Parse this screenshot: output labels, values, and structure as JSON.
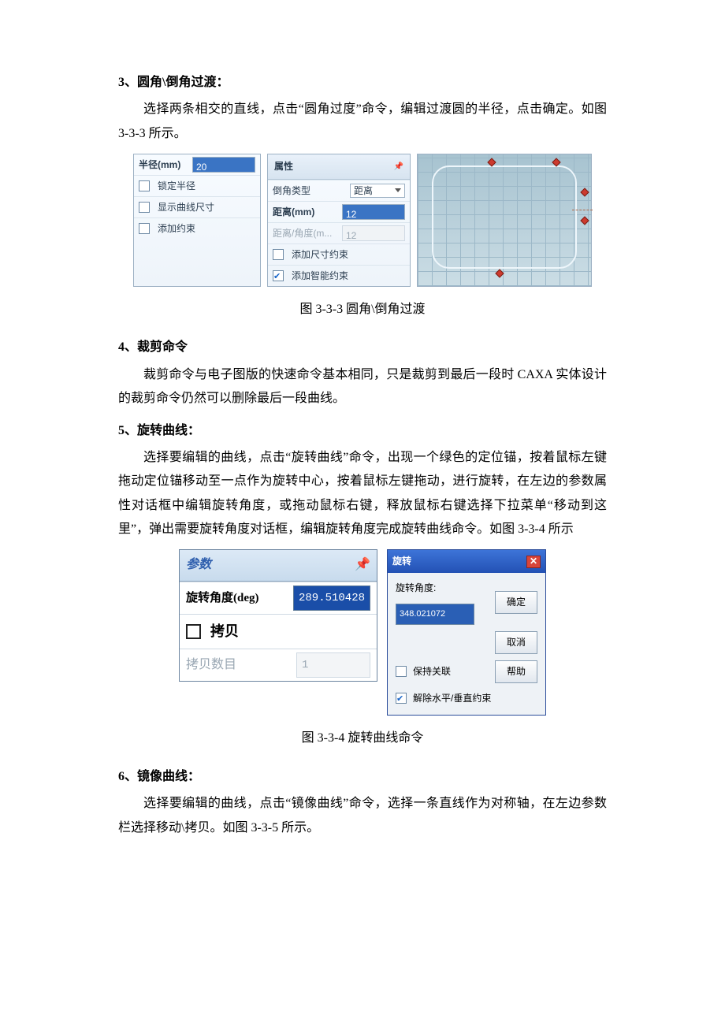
{
  "sec3": {
    "heading": "3、圆角\\倒角过渡：",
    "para": "选择两条相交的直线，点击“圆角过度”命令，编辑过渡圆的半径，点击确定。如图 3-3-3 所示。",
    "caption": "图 3-3-3 圆角\\倒角过渡",
    "panel_left": {
      "radius_label": "半径(mm)",
      "radius_value": "20",
      "lock_radius": "锁定半径",
      "show_dim": "显示曲线尺寸",
      "add_constraint": "添加约束"
    },
    "panel_mid": {
      "title": "属性",
      "chamfer_type_label": "倒角类型",
      "chamfer_type_value": "距离",
      "distance_label": "距离(mm)",
      "distance_value": "12",
      "dist_angle_label": "距离/角度(m...",
      "dist_angle_value": "12",
      "add_dim_constraint": "添加尺寸约束",
      "add_smart_constraint": "添加智能约束"
    }
  },
  "sec4": {
    "heading": "4、裁剪命令",
    "para": "裁剪命令与电子图版的快速命令基本相同，只是裁剪到最后一段时 CAXA 实体设计的裁剪命令仍然可以删除最后一段曲线。"
  },
  "sec5": {
    "heading": "5、旋转曲线：",
    "para": "选择要编辑的曲线，点击“旋转曲线”命令，出现一个绿色的定位锚，按着鼠标左键拖动定位锚移动至一点作为旋转中心，按着鼠标左键拖动，进行旋转，在左边的参数属性对话框中编辑旋转角度，或拖动鼠标右键，释放鼠标右键选择下拉菜单“移动到这里”，弹出需要旋转角度对话框，编辑旋转角度完成旋转曲线命令。如图 3-3-4 所示",
    "caption": "图 3-3-4 旋转曲线命令",
    "param_panel": {
      "title": "参数",
      "angle_label": "旋转角度(deg)",
      "angle_value": "289.510428",
      "copy_label": "拷贝",
      "copy_count_label": "拷贝数目",
      "copy_count_value": "1"
    },
    "rot_dialog": {
      "title": "旋转",
      "angle_label": "旋转角度:",
      "angle_value": "348.021072",
      "btn_ok": "确定",
      "btn_cancel": "取消",
      "btn_help": "帮助",
      "keep_link": "保持关联",
      "remove_hv": "解除水平/垂直约束"
    }
  },
  "sec6": {
    "heading": "6、镜像曲线：",
    "para": "选择要编辑的曲线，点击“镜像曲线”命令，选择一条直线作为对称轴，在左边参数栏选择移动\\拷贝。如图 3-3-5 所示。"
  }
}
